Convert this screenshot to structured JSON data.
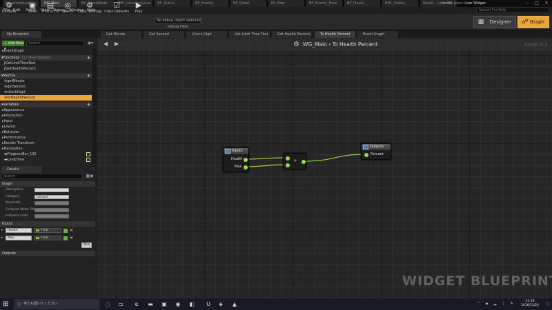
{
  "doc_tabs": [
    "ParameterLevel",
    "WG_Main",
    "BP_GameMode",
    "BP_GameInstance",
    "BP_Status",
    "BP_Enemy",
    "BP_Robot",
    "BP_Bow",
    "BP_Enemy_Boss",
    "BP_Player",
    "BML_Status",
    "Result - Level BG"
  ],
  "active_doc_tab": 1,
  "parent_class_label": "Parent class:",
  "parent_class_value": "User Widget",
  "menu": [
    "File",
    "Edit",
    "Asset",
    "View",
    "Debug",
    "Window",
    "Help"
  ],
  "search_help_placeholder": "Search For Help",
  "toolbar": {
    "compile": "Compile",
    "save": "Save",
    "find_in_cb": "Find in CB",
    "search": "Search",
    "class_settings": "Class Settings",
    "class_defaults": "Class Defaults",
    "play": "Play",
    "debug_select": "No debug object selected ▾",
    "debug_filter": "Debug Filter"
  },
  "modes": {
    "designer": "Designer",
    "graph": "Graph"
  },
  "graph_tabs": {
    "my_blueprint": "My Blueprint",
    "items": [
      "Get Minute",
      "Get Second",
      "Check Digit",
      "Get Limit Time Text",
      "Get Health Percent",
      "To Health Percent",
      "Event Graph"
    ],
    "active": 5
  },
  "my_blueprint": {
    "add_new": "+ Add New ▾",
    "search_placeholder": "Search",
    "event_graph": "EventGraph",
    "functions_header": "Functions",
    "functions_note": "(11 Overridable)",
    "functions": [
      "GetLimitTimeText",
      "GetHealthPercent"
    ],
    "macros_header": "Macros",
    "macros": [
      "getMinute",
      "getSecond",
      "checkDigit",
      "ToHealthPercent"
    ],
    "selected_macro": 3,
    "variables_header": "Variables",
    "variable_categories": [
      "Appearance",
      "Interaction",
      "Input",
      "Layout",
      "Behavior",
      "Performance",
      "Render Transform",
      "Navigation"
    ],
    "variables": [
      "ProgressBar_136",
      "LimitTime"
    ]
  },
  "details": {
    "tab": "Details",
    "search_placeholder": "Search",
    "graph_header": "Graph",
    "props": [
      {
        "label": "Description",
        "value": ""
      },
      {
        "label": "Category",
        "value": "Default"
      },
      {
        "label": "Keywords",
        "value": ""
      },
      {
        "label": "Compact Node Title",
        "value": ""
      },
      {
        "label": "Instance Color",
        "value": ""
      }
    ],
    "inputs_header": "Inputs",
    "inputs": [
      {
        "name": "Health",
        "type": "Float"
      },
      {
        "name": "Max",
        "type": "Float"
      }
    ],
    "new_button": "New",
    "outputs_header": "Outputs"
  },
  "graph": {
    "breadcrumb_root": "WG_Main",
    "breadcrumb_sep": "›",
    "breadcrumb_leaf": "To Health Percent",
    "zoom": "Zoom 1:1",
    "watermark": "WIDGET BLUEPRINT",
    "inputs_node": {
      "title": "Inputs",
      "pins": [
        "Health",
        "Max"
      ]
    },
    "divide_node": {
      "symbol": "÷"
    },
    "outputs_node": {
      "title": "Outputs",
      "pins": [
        "Percent"
      ]
    },
    "colors": {
      "float_pin": "#98d94d",
      "wire": "#9bd34f"
    }
  },
  "taskbar": {
    "search_placeholder": "何でも聞いてください",
    "time": "23:39",
    "date": "2016/12/23"
  }
}
